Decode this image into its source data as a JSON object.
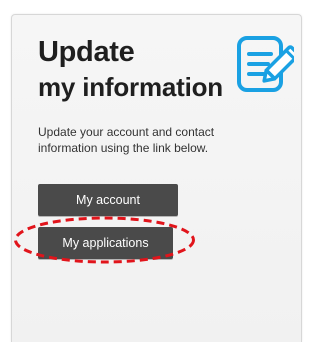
{
  "card": {
    "title": "Update",
    "subtitle": "my information",
    "description": "Update your account and contact information using the link below.",
    "icon": "edit-document-icon"
  },
  "buttons": {
    "my_account": "My account",
    "my_applications": "My applications"
  },
  "colors": {
    "icon_blue": "#1aa1e3",
    "button_bg": "#4a4a4a",
    "highlight_red": "#e1141b"
  }
}
